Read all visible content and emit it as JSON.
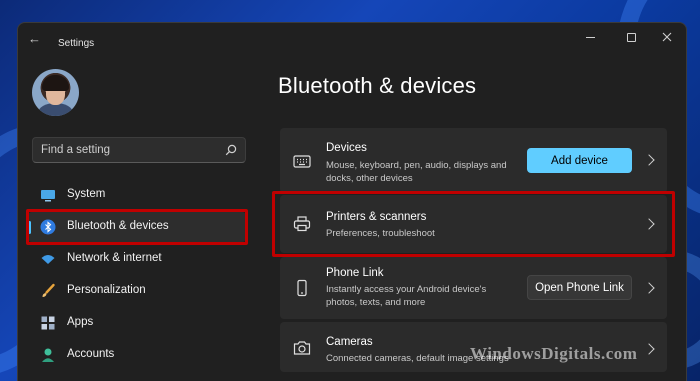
{
  "window": {
    "title": "Settings",
    "back_label": "←"
  },
  "search": {
    "placeholder": "Find a setting"
  },
  "sidebar": {
    "items": [
      {
        "label": "System",
        "icon": "monitor-icon"
      },
      {
        "label": "Bluetooth & devices",
        "icon": "bluetooth-icon",
        "active": true
      },
      {
        "label": "Network & internet",
        "icon": "wifi-icon"
      },
      {
        "label": "Personalization",
        "icon": "brush-icon"
      },
      {
        "label": "Apps",
        "icon": "apps-icon"
      },
      {
        "label": "Accounts",
        "icon": "person-icon"
      }
    ]
  },
  "main": {
    "title": "Bluetooth & devices",
    "cards": [
      {
        "title": "Devices",
        "desc": "Mouse, keyboard, pen, audio, displays and docks, other devices",
        "button": "Add device",
        "icon": "keyboard-icon"
      },
      {
        "title": "Printers & scanners",
        "desc": "Preferences, troubleshoot",
        "icon": "printer-icon"
      },
      {
        "title": "Phone Link",
        "desc": "Instantly access your Android device's photos, texts, and more",
        "button": "Open Phone Link",
        "icon": "phone-icon"
      },
      {
        "title": "Cameras",
        "desc": "Connected cameras, default image settings",
        "icon": "camera-icon"
      }
    ]
  },
  "watermark": "WindowsDigitals.com",
  "colors": {
    "accent": "#60cdff",
    "highlight": "#c00000",
    "window_bg": "#202020",
    "card_bg": "#2b2b2b"
  }
}
